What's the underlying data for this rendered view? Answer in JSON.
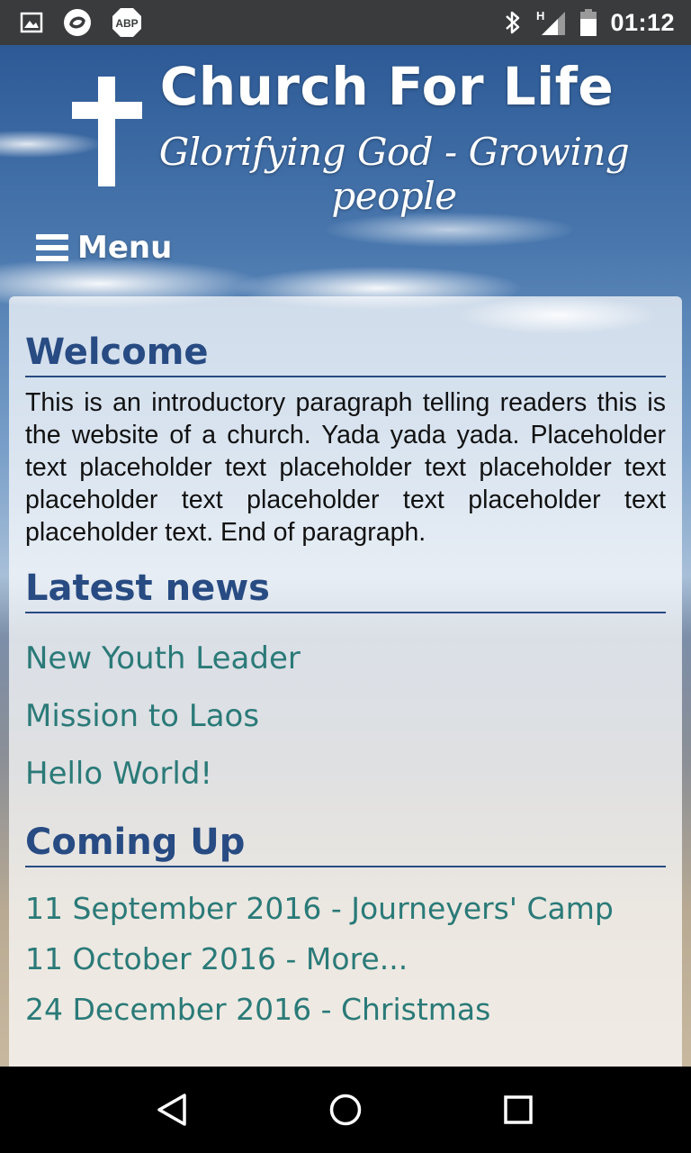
{
  "status_bar": {
    "left_icons": [
      "image-icon",
      "sync-icon",
      "adblock-icon"
    ],
    "adblock_label": "ABP",
    "network_label": "H",
    "time": "01:12"
  },
  "header": {
    "title": "Church For Life",
    "tagline": "Glorifying God - Growing people",
    "menu_label": "Menu"
  },
  "welcome": {
    "heading": "Welcome",
    "paragraph": "This is an introductory paragraph telling readers this is the website of a church. Yada yada yada. Placeholder text placeholder text placeholder text placeholder text placeholder text placeholder text placeholder text placeholder text. End of paragraph."
  },
  "latest_news": {
    "heading": "Latest news",
    "items": [
      "New Youth Leader",
      "Mission to Laos",
      "Hello World!"
    ]
  },
  "coming_up": {
    "heading": "Coming Up",
    "items": [
      "11 September 2016 - Journeyers' Camp",
      "11 October 2016 - More...",
      "24 December 2016 - Christmas"
    ]
  },
  "nav_bar": {
    "buttons": [
      "back-icon",
      "home-icon",
      "recents-icon"
    ]
  }
}
